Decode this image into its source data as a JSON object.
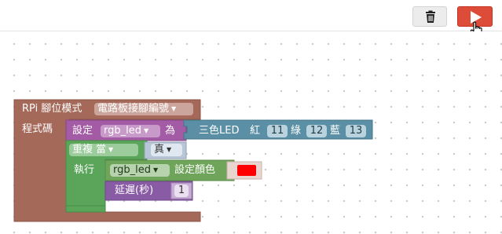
{
  "toolbar": {
    "trash_icon": "trash-icon",
    "run_icon": "play-icon",
    "cursor_icon": "hand-pointer-icon"
  },
  "blocks": {
    "rpi_pin_mode": {
      "label": "RPi 腳位模式",
      "dropdown_value": "電路板接腳編號",
      "code_label": "程式碼",
      "color": "#a5695a"
    },
    "set_var": {
      "label": "設定",
      "var_name": "rgb_led",
      "to_label": "為",
      "color": "#a45ba5"
    },
    "rgb_led_create": {
      "label": "三色LED",
      "red_label": "紅",
      "red_pin": "11",
      "green_label": "綠",
      "green_pin": "12",
      "blue_label": "藍",
      "blue_pin": "13",
      "color": "#5b8fa5"
    },
    "repeat": {
      "label": "重複",
      "mode": "當",
      "condition": "真",
      "do_label": "執行",
      "color": "#5ba55b"
    },
    "set_color": {
      "var_name": "rgb_led",
      "label": "設定顏色",
      "color_value": "#ff0000",
      "color": "#6ea55b"
    },
    "delay": {
      "label": "延遲(秒)",
      "value": "1",
      "color": "#8a5ba5"
    }
  }
}
